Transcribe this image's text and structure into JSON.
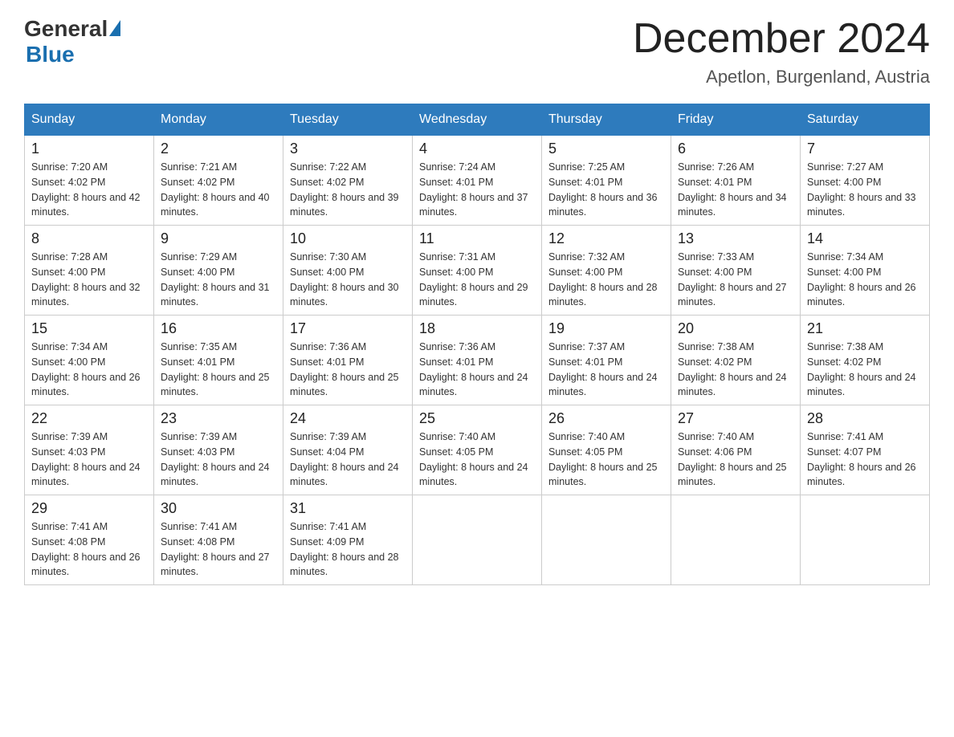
{
  "logo": {
    "general": "General",
    "blue": "Blue"
  },
  "title": "December 2024",
  "subtitle": "Apetlon, Burgenland, Austria",
  "headers": [
    "Sunday",
    "Monday",
    "Tuesday",
    "Wednesday",
    "Thursday",
    "Friday",
    "Saturday"
  ],
  "weeks": [
    [
      {
        "day": "1",
        "sunrise": "7:20 AM",
        "sunset": "4:02 PM",
        "daylight": "8 hours and 42 minutes."
      },
      {
        "day": "2",
        "sunrise": "7:21 AM",
        "sunset": "4:02 PM",
        "daylight": "8 hours and 40 minutes."
      },
      {
        "day": "3",
        "sunrise": "7:22 AM",
        "sunset": "4:02 PM",
        "daylight": "8 hours and 39 minutes."
      },
      {
        "day": "4",
        "sunrise": "7:24 AM",
        "sunset": "4:01 PM",
        "daylight": "8 hours and 37 minutes."
      },
      {
        "day": "5",
        "sunrise": "7:25 AM",
        "sunset": "4:01 PM",
        "daylight": "8 hours and 36 minutes."
      },
      {
        "day": "6",
        "sunrise": "7:26 AM",
        "sunset": "4:01 PM",
        "daylight": "8 hours and 34 minutes."
      },
      {
        "day": "7",
        "sunrise": "7:27 AM",
        "sunset": "4:00 PM",
        "daylight": "8 hours and 33 minutes."
      }
    ],
    [
      {
        "day": "8",
        "sunrise": "7:28 AM",
        "sunset": "4:00 PM",
        "daylight": "8 hours and 32 minutes."
      },
      {
        "day": "9",
        "sunrise": "7:29 AM",
        "sunset": "4:00 PM",
        "daylight": "8 hours and 31 minutes."
      },
      {
        "day": "10",
        "sunrise": "7:30 AM",
        "sunset": "4:00 PM",
        "daylight": "8 hours and 30 minutes."
      },
      {
        "day": "11",
        "sunrise": "7:31 AM",
        "sunset": "4:00 PM",
        "daylight": "8 hours and 29 minutes."
      },
      {
        "day": "12",
        "sunrise": "7:32 AM",
        "sunset": "4:00 PM",
        "daylight": "8 hours and 28 minutes."
      },
      {
        "day": "13",
        "sunrise": "7:33 AM",
        "sunset": "4:00 PM",
        "daylight": "8 hours and 27 minutes."
      },
      {
        "day": "14",
        "sunrise": "7:34 AM",
        "sunset": "4:00 PM",
        "daylight": "8 hours and 26 minutes."
      }
    ],
    [
      {
        "day": "15",
        "sunrise": "7:34 AM",
        "sunset": "4:00 PM",
        "daylight": "8 hours and 26 minutes."
      },
      {
        "day": "16",
        "sunrise": "7:35 AM",
        "sunset": "4:01 PM",
        "daylight": "8 hours and 25 minutes."
      },
      {
        "day": "17",
        "sunrise": "7:36 AM",
        "sunset": "4:01 PM",
        "daylight": "8 hours and 25 minutes."
      },
      {
        "day": "18",
        "sunrise": "7:36 AM",
        "sunset": "4:01 PM",
        "daylight": "8 hours and 24 minutes."
      },
      {
        "day": "19",
        "sunrise": "7:37 AM",
        "sunset": "4:01 PM",
        "daylight": "8 hours and 24 minutes."
      },
      {
        "day": "20",
        "sunrise": "7:38 AM",
        "sunset": "4:02 PM",
        "daylight": "8 hours and 24 minutes."
      },
      {
        "day": "21",
        "sunrise": "7:38 AM",
        "sunset": "4:02 PM",
        "daylight": "8 hours and 24 minutes."
      }
    ],
    [
      {
        "day": "22",
        "sunrise": "7:39 AM",
        "sunset": "4:03 PM",
        "daylight": "8 hours and 24 minutes."
      },
      {
        "day": "23",
        "sunrise": "7:39 AM",
        "sunset": "4:03 PM",
        "daylight": "8 hours and 24 minutes."
      },
      {
        "day": "24",
        "sunrise": "7:39 AM",
        "sunset": "4:04 PM",
        "daylight": "8 hours and 24 minutes."
      },
      {
        "day": "25",
        "sunrise": "7:40 AM",
        "sunset": "4:05 PM",
        "daylight": "8 hours and 24 minutes."
      },
      {
        "day": "26",
        "sunrise": "7:40 AM",
        "sunset": "4:05 PM",
        "daylight": "8 hours and 25 minutes."
      },
      {
        "day": "27",
        "sunrise": "7:40 AM",
        "sunset": "4:06 PM",
        "daylight": "8 hours and 25 minutes."
      },
      {
        "day": "28",
        "sunrise": "7:41 AM",
        "sunset": "4:07 PM",
        "daylight": "8 hours and 26 minutes."
      }
    ],
    [
      {
        "day": "29",
        "sunrise": "7:41 AM",
        "sunset": "4:08 PM",
        "daylight": "8 hours and 26 minutes."
      },
      {
        "day": "30",
        "sunrise": "7:41 AM",
        "sunset": "4:08 PM",
        "daylight": "8 hours and 27 minutes."
      },
      {
        "day": "31",
        "sunrise": "7:41 AM",
        "sunset": "4:09 PM",
        "daylight": "8 hours and 28 minutes."
      },
      null,
      null,
      null,
      null
    ]
  ]
}
